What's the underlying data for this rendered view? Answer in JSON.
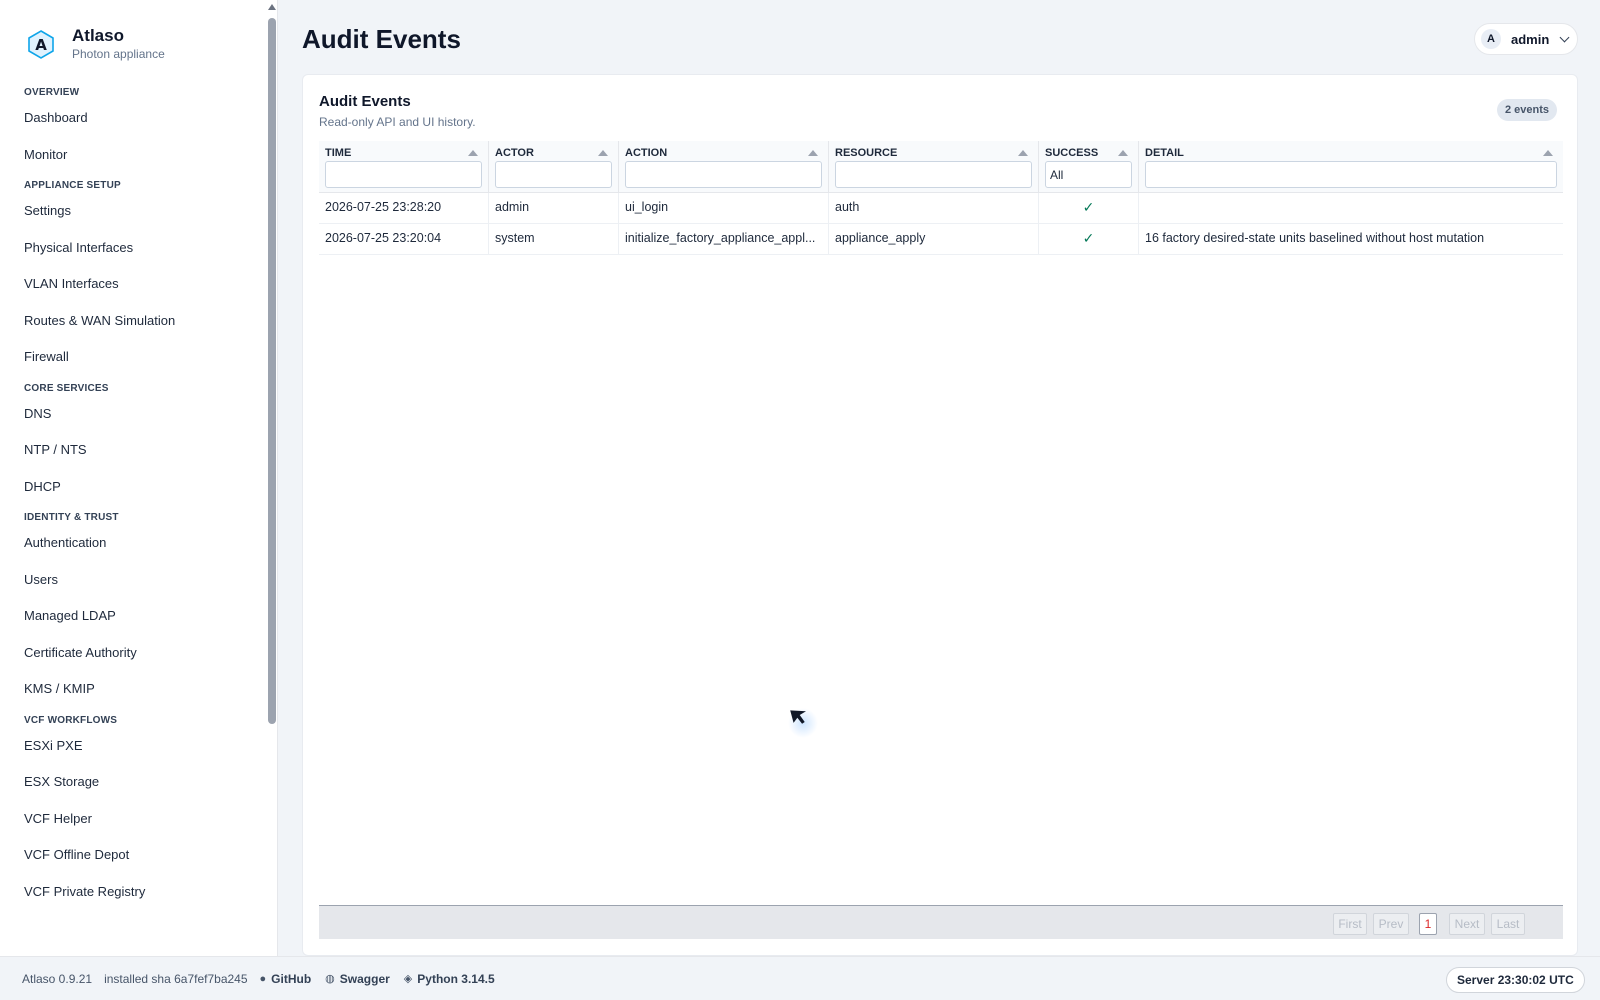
{
  "brand": {
    "name": "Atlaso",
    "subtitle": "Photon appliance"
  },
  "sidebar": {
    "sections": [
      {
        "title": "OVERVIEW",
        "items": [
          "Dashboard",
          "Monitor"
        ]
      },
      {
        "title": "APPLIANCE SETUP",
        "items": [
          "Settings",
          "Physical Interfaces",
          "VLAN Interfaces",
          "Routes & WAN Simulation",
          "Firewall"
        ]
      },
      {
        "title": "CORE SERVICES",
        "items": [
          "DNS",
          "NTP / NTS",
          "DHCP"
        ]
      },
      {
        "title": "IDENTITY & TRUST",
        "items": [
          "Authentication",
          "Users",
          "Managed LDAP",
          "Certificate Authority",
          "KMS / KMIP"
        ]
      },
      {
        "title": "VCF WORKFLOWS",
        "items": [
          "ESXi PXE",
          "ESX Storage",
          "VCF Helper",
          "VCF Offline Depot",
          "VCF Private Registry"
        ]
      }
    ]
  },
  "header": {
    "title": "Audit Events",
    "user": {
      "initial": "A",
      "name": "admin"
    }
  },
  "card": {
    "title": "Audit Events",
    "subtitle": "Read-only API and UI history.",
    "count_badge": "2 events"
  },
  "table": {
    "columns": [
      "TIME",
      "ACTOR",
      "ACTION",
      "RESOURCE",
      "SUCCESS",
      "DETAIL"
    ],
    "success_filter": "All",
    "rows": [
      {
        "time": "2026-07-25 23:28:20",
        "actor": "admin",
        "action": "ui_login",
        "resource": "auth",
        "success": "✓",
        "detail": ""
      },
      {
        "time": "2026-07-25 23:20:04",
        "actor": "system",
        "action": "initialize_factory_appliance_appl...",
        "resource": "appliance_apply",
        "success": "✓",
        "detail": "16 factory desired-state units baselined without host mutation"
      }
    ]
  },
  "pager": {
    "first": "First",
    "prev": "Prev",
    "page": "1",
    "next": "Next",
    "last": "Last"
  },
  "footer": {
    "version": "Atlaso 0.9.21",
    "sha": "installed sha 6a7fef7ba245",
    "github": "GitHub",
    "swagger": "Swagger",
    "python": "Python 3.14.5",
    "server_time": "Server 23:30:02 UTC"
  }
}
